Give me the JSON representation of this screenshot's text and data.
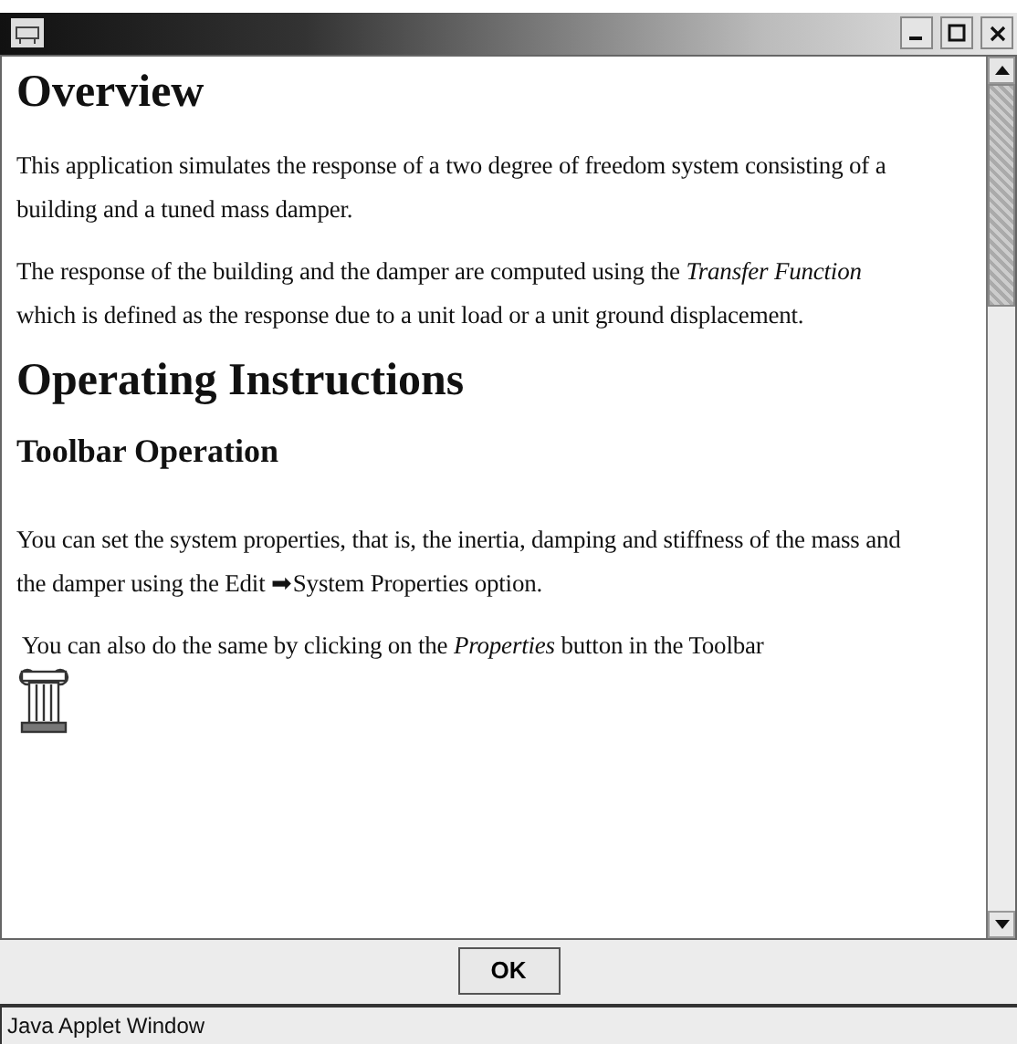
{
  "content": [
    {
      "kind": "h1",
      "text": "Overview"
    },
    {
      "kind": "p",
      "text": "This application simulates the response of a two degree of freedom system consisting of a building and a tuned mass damper."
    },
    {
      "kind": "p",
      "text": "The response of the building and the damper are computed using the *Transfer Function* which is defined as the response due to a unit load or a unit ground displacement."
    },
    {
      "kind": "h1",
      "text": "Operating Instructions"
    },
    {
      "kind": "h2",
      "text": "Toolbar Operation"
    },
    {
      "kind": "p",
      "text": "You can set the system properties, that is, the inertia, damping and stiffness of the mass and the damper using the Edit ➡System Properties option."
    },
    {
      "kind": "column-p",
      "text": "You can also do the same by clicking on the *Properties* button in the Toolbar"
    }
  ],
  "button": "OK",
  "status_bar": "Java Applet Window"
}
